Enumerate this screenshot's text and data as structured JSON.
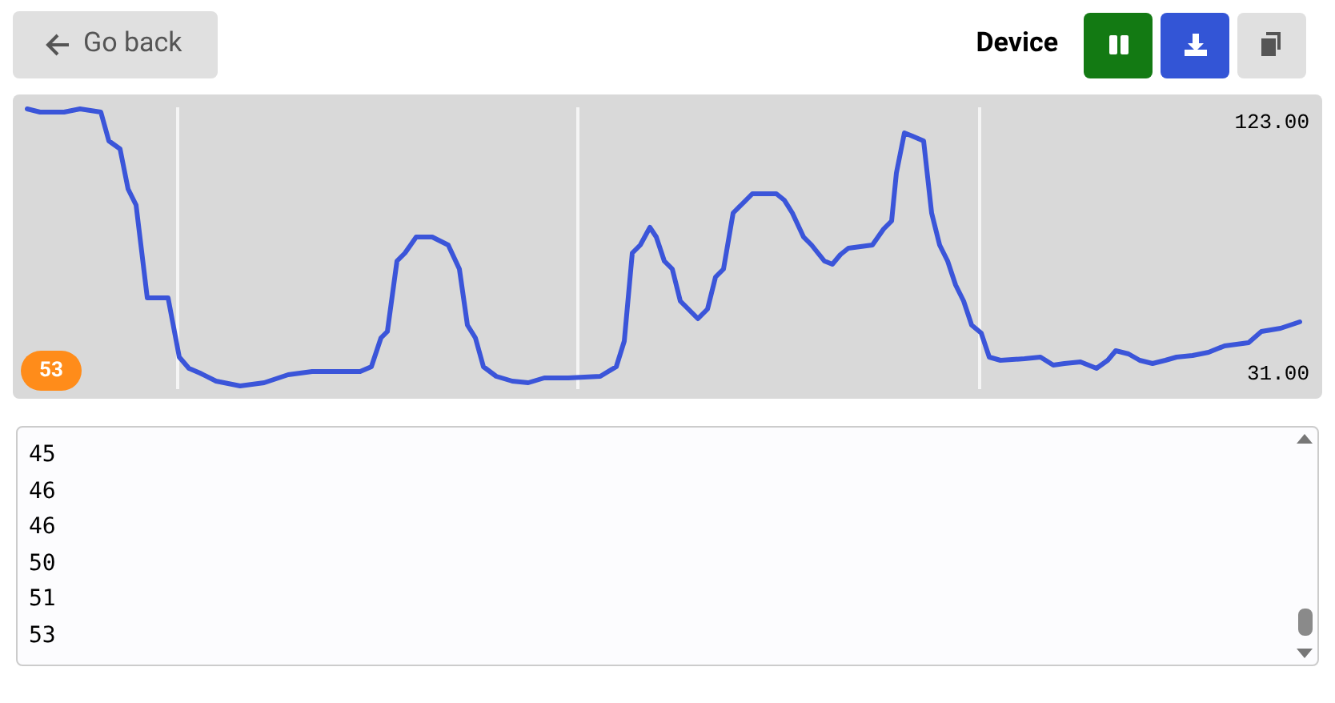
{
  "back_button": {
    "label": "Go back"
  },
  "device_label": "Device",
  "plot": {
    "max_label": "123.00",
    "min_label": "31.00",
    "current_value": "53"
  },
  "log": {
    "lines": [
      "45",
      "46",
      "46",
      "50",
      "51",
      "53"
    ]
  }
}
